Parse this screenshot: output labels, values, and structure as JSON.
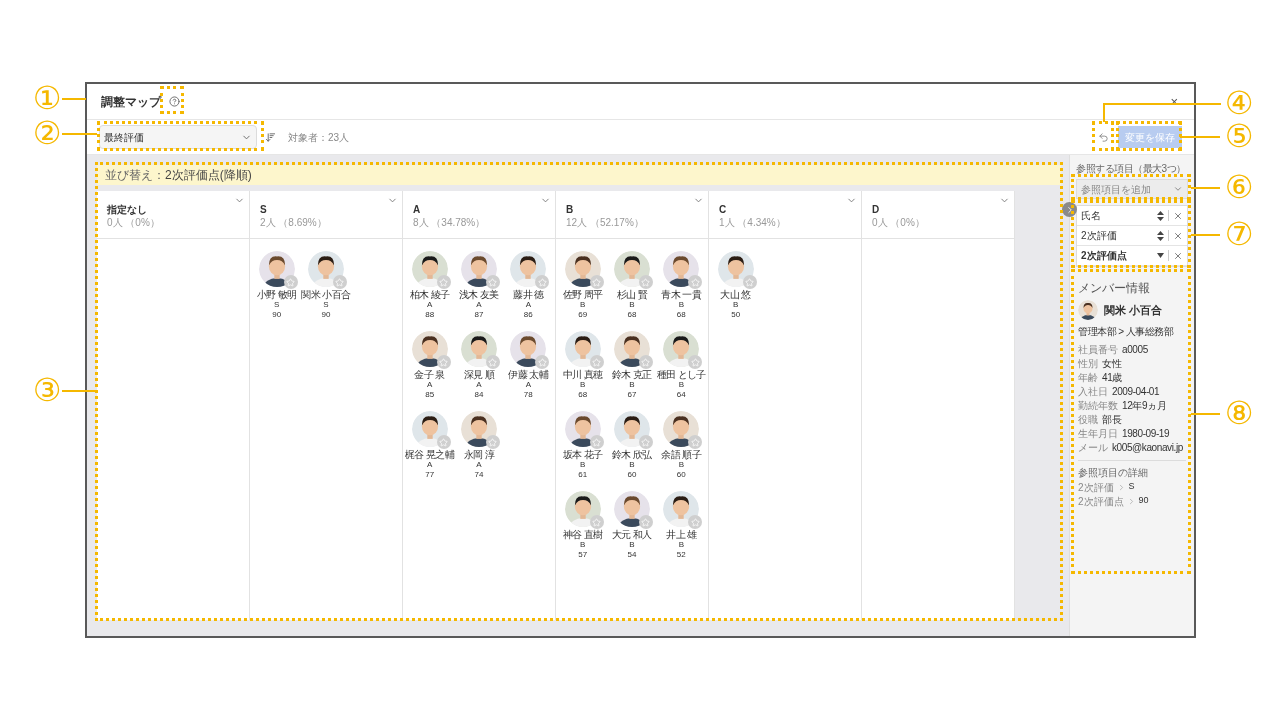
{
  "window": {
    "title": "調整マップ",
    "close": "×"
  },
  "toolbar": {
    "evaluation_select": "最終評価",
    "target_count": "対象者：23人"
  },
  "actions": {
    "save": "変更を保存",
    "save_disabled": true
  },
  "sort_banner": {
    "label": "並び替え：",
    "value": "2次評価点(降順)"
  },
  "columns": [
    {
      "title": "指定なし",
      "count": "0人 （0%）"
    },
    {
      "title": "S",
      "count": "2人 （8.69%）",
      "members": [
        {
          "name": "小野 敏明",
          "grade": "S",
          "score": "90"
        },
        {
          "name": "関米 小百合",
          "grade": "S",
          "score": "90"
        }
      ]
    },
    {
      "title": "A",
      "count": "8人 （34.78%）",
      "members": [
        {
          "name": "柏木 綾子",
          "grade": "A",
          "score": "88"
        },
        {
          "name": "浅木 友美",
          "grade": "A",
          "score": "87"
        },
        {
          "name": "藤井 徳",
          "grade": "A",
          "score": "86"
        },
        {
          "name": "金子 泉",
          "grade": "A",
          "score": "85"
        },
        {
          "name": "深見 順",
          "grade": "A",
          "score": "84"
        },
        {
          "name": "伊藤 太輔",
          "grade": "A",
          "score": "78"
        },
        {
          "name": "梶谷 晃之輔",
          "grade": "A",
          "score": "77"
        },
        {
          "name": "永岡 淳",
          "grade": "A",
          "score": "74"
        }
      ]
    },
    {
      "title": "B",
      "count": "12人 （52.17%）",
      "members": [
        {
          "name": "佐野 周平",
          "grade": "B",
          "score": "69"
        },
        {
          "name": "杉山 賢",
          "grade": "B",
          "score": "68"
        },
        {
          "name": "青木 一貴",
          "grade": "B",
          "score": "68"
        },
        {
          "name": "中川 真穂",
          "grade": "B",
          "score": "68"
        },
        {
          "name": "鈴木 克正",
          "grade": "B",
          "score": "67"
        },
        {
          "name": "種田 とし子",
          "grade": "B",
          "score": "64"
        },
        {
          "name": "坂本 花子",
          "grade": "B",
          "score": "61"
        },
        {
          "name": "鈴木 欣弘",
          "grade": "B",
          "score": "60"
        },
        {
          "name": "余語 順子",
          "grade": "B",
          "score": "60"
        },
        {
          "name": "神谷 直樹",
          "grade": "B",
          "score": "57"
        },
        {
          "name": "大元 和人",
          "grade": "B",
          "score": "54"
        },
        {
          "name": "井上 雄",
          "grade": "B",
          "score": "52"
        }
      ]
    },
    {
      "title": "C",
      "count": "1人 （4.34%）",
      "members": [
        {
          "name": "大山 悠",
          "grade": "B",
          "score": "50"
        }
      ]
    },
    {
      "title": "D",
      "count": "0人 （0%）"
    }
  ],
  "reference_panel": {
    "heading": "参照する項目（最大3つ）",
    "add_placeholder": "参照項目を追加",
    "items": [
      {
        "label": "氏名",
        "kind": "both"
      },
      {
        "label": "2次評価",
        "kind": "both"
      },
      {
        "label": "2次評価点",
        "kind": "desc"
      }
    ]
  },
  "member_info": {
    "heading": "メンバー情報",
    "name": "関米 小百合",
    "department": "管理本部 > 人事総務部",
    "fields": [
      {
        "label": "社員番号",
        "value": "a0005"
      },
      {
        "label": "性別",
        "value": "女性"
      },
      {
        "label": "年齢",
        "value": "41歳"
      },
      {
        "label": "入社日",
        "value": "2009-04-01"
      },
      {
        "label": "勤続年数",
        "value": "12年9ヵ月"
      },
      {
        "label": "役職",
        "value": "部長"
      },
      {
        "label": "生年月日",
        "value": "1980-09-19"
      },
      {
        "label": "メール",
        "value": "k005@kaonavi.jp"
      }
    ],
    "details_heading": "参照項目の詳細",
    "details": [
      {
        "label": "2次評価",
        "value": "S"
      },
      {
        "label": "2次評価点",
        "value": "90"
      }
    ]
  },
  "callouts": [
    "①",
    "②",
    "③",
    "④",
    "⑤",
    "⑥",
    "⑦",
    "⑧"
  ]
}
